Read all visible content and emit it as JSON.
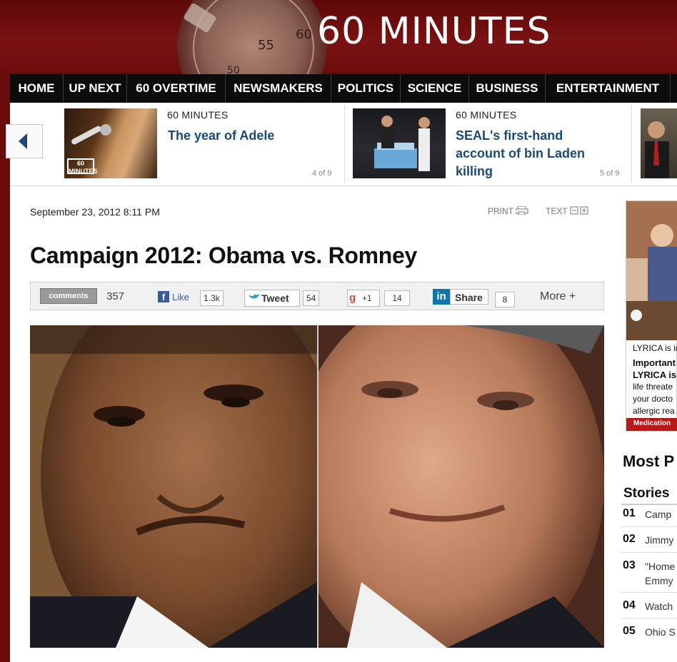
{
  "header": {
    "logo": "60 MINUTES",
    "stopwatch_numbers": [
      "55",
      "60",
      "50"
    ]
  },
  "nav": {
    "items": [
      "HOME",
      "UP NEXT",
      "60 OVERTIME",
      "NEWSMAKERS",
      "POLITICS",
      "SCIENCE",
      "BUSINESS",
      "ENTERTAINMENT"
    ]
  },
  "carousel": {
    "items": [
      {
        "kicker": "60 MINUTES",
        "title": "The year of Adele",
        "count": "4 of 9",
        "thumb_badge": "60 MINUTES"
      },
      {
        "kicker": "60 MINUTES",
        "title_line1": "SEAL's first-hand",
        "title_line2": "account of bin Laden",
        "title_line3": "killing",
        "count": "5 of 9"
      }
    ]
  },
  "article": {
    "date": "September 23, 2012 8:11 PM",
    "print_label": "PRINT",
    "text_label": "TEXT",
    "title": "Campaign 2012: Obama vs. Romney"
  },
  "share": {
    "comments_label": "comments",
    "comments_count": "357",
    "like_label": "Like",
    "like_count": "1.3k",
    "tweet_label": "Tweet",
    "tweet_count": "54",
    "plusone_label": "+1",
    "plusone_count": "14",
    "linkedin_label": "Share",
    "linkedin_count": "8",
    "more_label": "More +"
  },
  "ad": {
    "line1": "LYRICA is ir",
    "line2": "Important",
    "line3": "LYRICA is",
    "line4": "life threate",
    "line5": "your docto",
    "line6": "allergic rea",
    "bar": "Medication"
  },
  "most_popular": {
    "heading": "Most P",
    "subheading": "Stories",
    "items": [
      {
        "num": "01",
        "text": "Camp"
      },
      {
        "num": "02",
        "text": "Jimmy"
      },
      {
        "num": "03",
        "text": "\"Home",
        "text2": "Emmy"
      },
      {
        "num": "04",
        "text": "Watch"
      },
      {
        "num": "05",
        "text": "Ohio S"
      }
    ]
  },
  "colors": {
    "header_red": "#7a1212",
    "nav_black": "#0c0c0c",
    "headline_blue": "#1a4a7a",
    "ad_red": "#b81818"
  }
}
